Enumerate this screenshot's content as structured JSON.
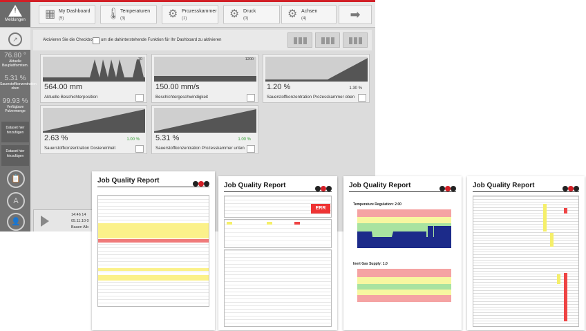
{
  "header": {
    "warning_label": "Meldungen",
    "tabs": [
      {
        "icon": "dashboard-icon",
        "title": "My Dashboard",
        "count": "(5)"
      },
      {
        "icon": "thermometer-icon",
        "title": "Temperaturen",
        "count": "(3)"
      },
      {
        "icon": "gear-icon",
        "title": "Prozesskammer",
        "count": "(1)"
      },
      {
        "icon": "gear-icon",
        "title": "Druck",
        "count": "(0)"
      },
      {
        "icon": "gear-icon",
        "title": "Achsen",
        "count": "(4)"
      }
    ],
    "next_icon": "arrow-right-icon"
  },
  "sidebar": {
    "values": [
      {
        "value": "76.80 °",
        "label": "Aktuelle Bauplattformtem."
      },
      {
        "value": "5.31 %",
        "label": "Sauerstoffkonzentration oben"
      },
      {
        "value": "99.93 %",
        "label": "Verfügbare Pulvermenge"
      }
    ],
    "buttons": [
      "Dataset hier hinzufügen",
      "Dataset hier hinzufügen"
    ],
    "icons": [
      "clipboard-icon",
      "a-circle-icon",
      "user-icon"
    ]
  },
  "dashboard": {
    "checkbox_label_before": "Aktivieren Sie die Checkbox",
    "checkbox_label_after": "um die dahinterstehende Funktion für Ihr Dashboard zu aktivieren",
    "tiles": [
      {
        "value": "564.00 mm",
        "label": "Aktuelle Beschichterposition",
        "scale": "70",
        "pct": ""
      },
      {
        "value": "150.00 mm/s",
        "label": "Beschichtergeschwindigkeit",
        "scale": "1200",
        "pct": ""
      },
      {
        "value": "1.20 %",
        "label": "Sauerstoffkonzentration Prozesskammer oben",
        "scale": "",
        "pct": "1.30 %"
      },
      {
        "value": "2.63 %",
        "label": "Sauerstoffkonzentration Dosiereinheit",
        "scale": "",
        "pct": "1.00 %"
      },
      {
        "value": "5.31 %",
        "label": "Sauerstoffkonzentration Prozesskammer unten",
        "scale": "",
        "pct": "1.00 %"
      }
    ]
  },
  "bottom_panel": {
    "line1": "14:46   14",
    "line2": "05.11.10   0",
    "line3": "Bauen   Alb"
  },
  "reports": [
    {
      "title": "Job Quality Report",
      "badge": ""
    },
    {
      "title": "Job Quality Report",
      "badge": "ERR"
    },
    {
      "title": "Job Quality Report",
      "chart1": "Temperature Regulation: 2.00",
      "chart2": "Inert Gas Supply: 1.0"
    },
    {
      "title": "Job Quality Report"
    }
  ],
  "colors": {
    "accent": "#d21f26",
    "ok": "#2e9b2e"
  }
}
